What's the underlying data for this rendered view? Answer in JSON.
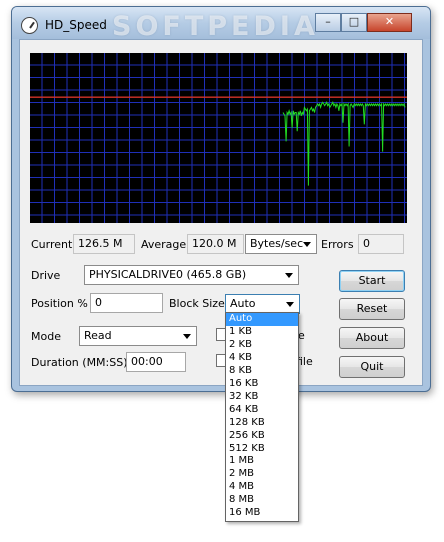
{
  "window": {
    "title": "HD_Speed",
    "watermark": "SOFTPEDIA",
    "controls": {
      "minimize": "–",
      "maximize": "□",
      "close": "✕"
    }
  },
  "stats": {
    "current_label": "Current",
    "current_value": "126.5 M",
    "average_label": "Average",
    "average_value": "120.0 M",
    "unit_selected": "Bytes/sec",
    "errors_label": "Errors",
    "errors_value": "0"
  },
  "form": {
    "drive_label": "Drive",
    "drive_value": "PHYSICALDRIVE0 (465.8 GB)",
    "position_label": "Position %",
    "position_value": "0",
    "block_size_label": "Block Size",
    "block_size_value": "Auto",
    "mode_label": "Mode",
    "mode_value": "Read",
    "duration_label": "Duration (MM:SS)",
    "duration_value": "00:00",
    "partial_label_1": "e",
    "partial_label_2": "file"
  },
  "buttons": {
    "start": "Start",
    "reset": "Reset",
    "about": "About",
    "quit": "Quit"
  },
  "block_size_options": [
    "Auto",
    "1 KB",
    "2 KB",
    "4 KB",
    "8 KB",
    "16 KB",
    "32 KB",
    "64 KB",
    "128 KB",
    "256 KB",
    "512 KB",
    "1 MB",
    "2 MB",
    "4 MB",
    "8 MB",
    "16 MB"
  ],
  "graph": {
    "background_color": "#000000",
    "grid_color": "#1f2fb8",
    "reference_line_color": "#d23228",
    "trace_color": "#22dd22",
    "trace_samples": [
      0.35,
      0.36,
      0.37,
      0.52,
      0.35,
      0.36,
      0.34,
      0.36,
      0.35,
      0.44,
      0.34,
      0.36,
      0.35,
      0.35,
      0.46,
      0.35,
      0.36,
      0.34,
      0.37,
      0.35,
      0.36,
      0.32,
      0.33,
      0.34,
      0.33,
      0.78,
      0.34,
      0.33,
      0.32,
      0.34,
      0.33,
      0.35,
      0.32,
      0.31,
      0.3,
      0.31,
      0.3,
      0.32,
      0.3,
      0.29,
      0.3,
      0.31,
      0.3,
      0.29,
      0.31,
      0.3,
      0.32,
      0.31,
      0.3,
      0.29,
      0.31,
      0.3,
      0.32,
      0.3,
      0.31,
      0.34,
      0.3,
      0.31,
      0.3,
      0.41,
      0.3,
      0.31,
      0.3,
      0.31,
      0.3,
      0.55,
      0.31,
      0.3,
      0.31,
      0.32,
      0.3,
      0.31,
      0.3,
      0.31,
      0.3,
      0.31,
      0.3,
      0.31,
      0.3,
      0.31,
      0.42,
      0.3,
      0.31,
      0.3,
      0.31,
      0.3,
      0.31,
      0.3,
      0.31,
      0.3,
      0.31,
      0.3,
      0.31,
      0.3,
      0.31,
      0.3,
      0.31,
      0.3,
      0.58,
      0.3,
      0.31,
      0.3,
      0.31,
      0.3,
      0.31,
      0.3,
      0.31,
      0.3,
      0.31,
      0.3,
      0.31,
      0.3,
      0.31,
      0.3,
      0.31,
      0.3,
      0.31,
      0.3,
      0.31,
      0.3,
      0.32
    ],
    "reference_level": 0.26
  }
}
